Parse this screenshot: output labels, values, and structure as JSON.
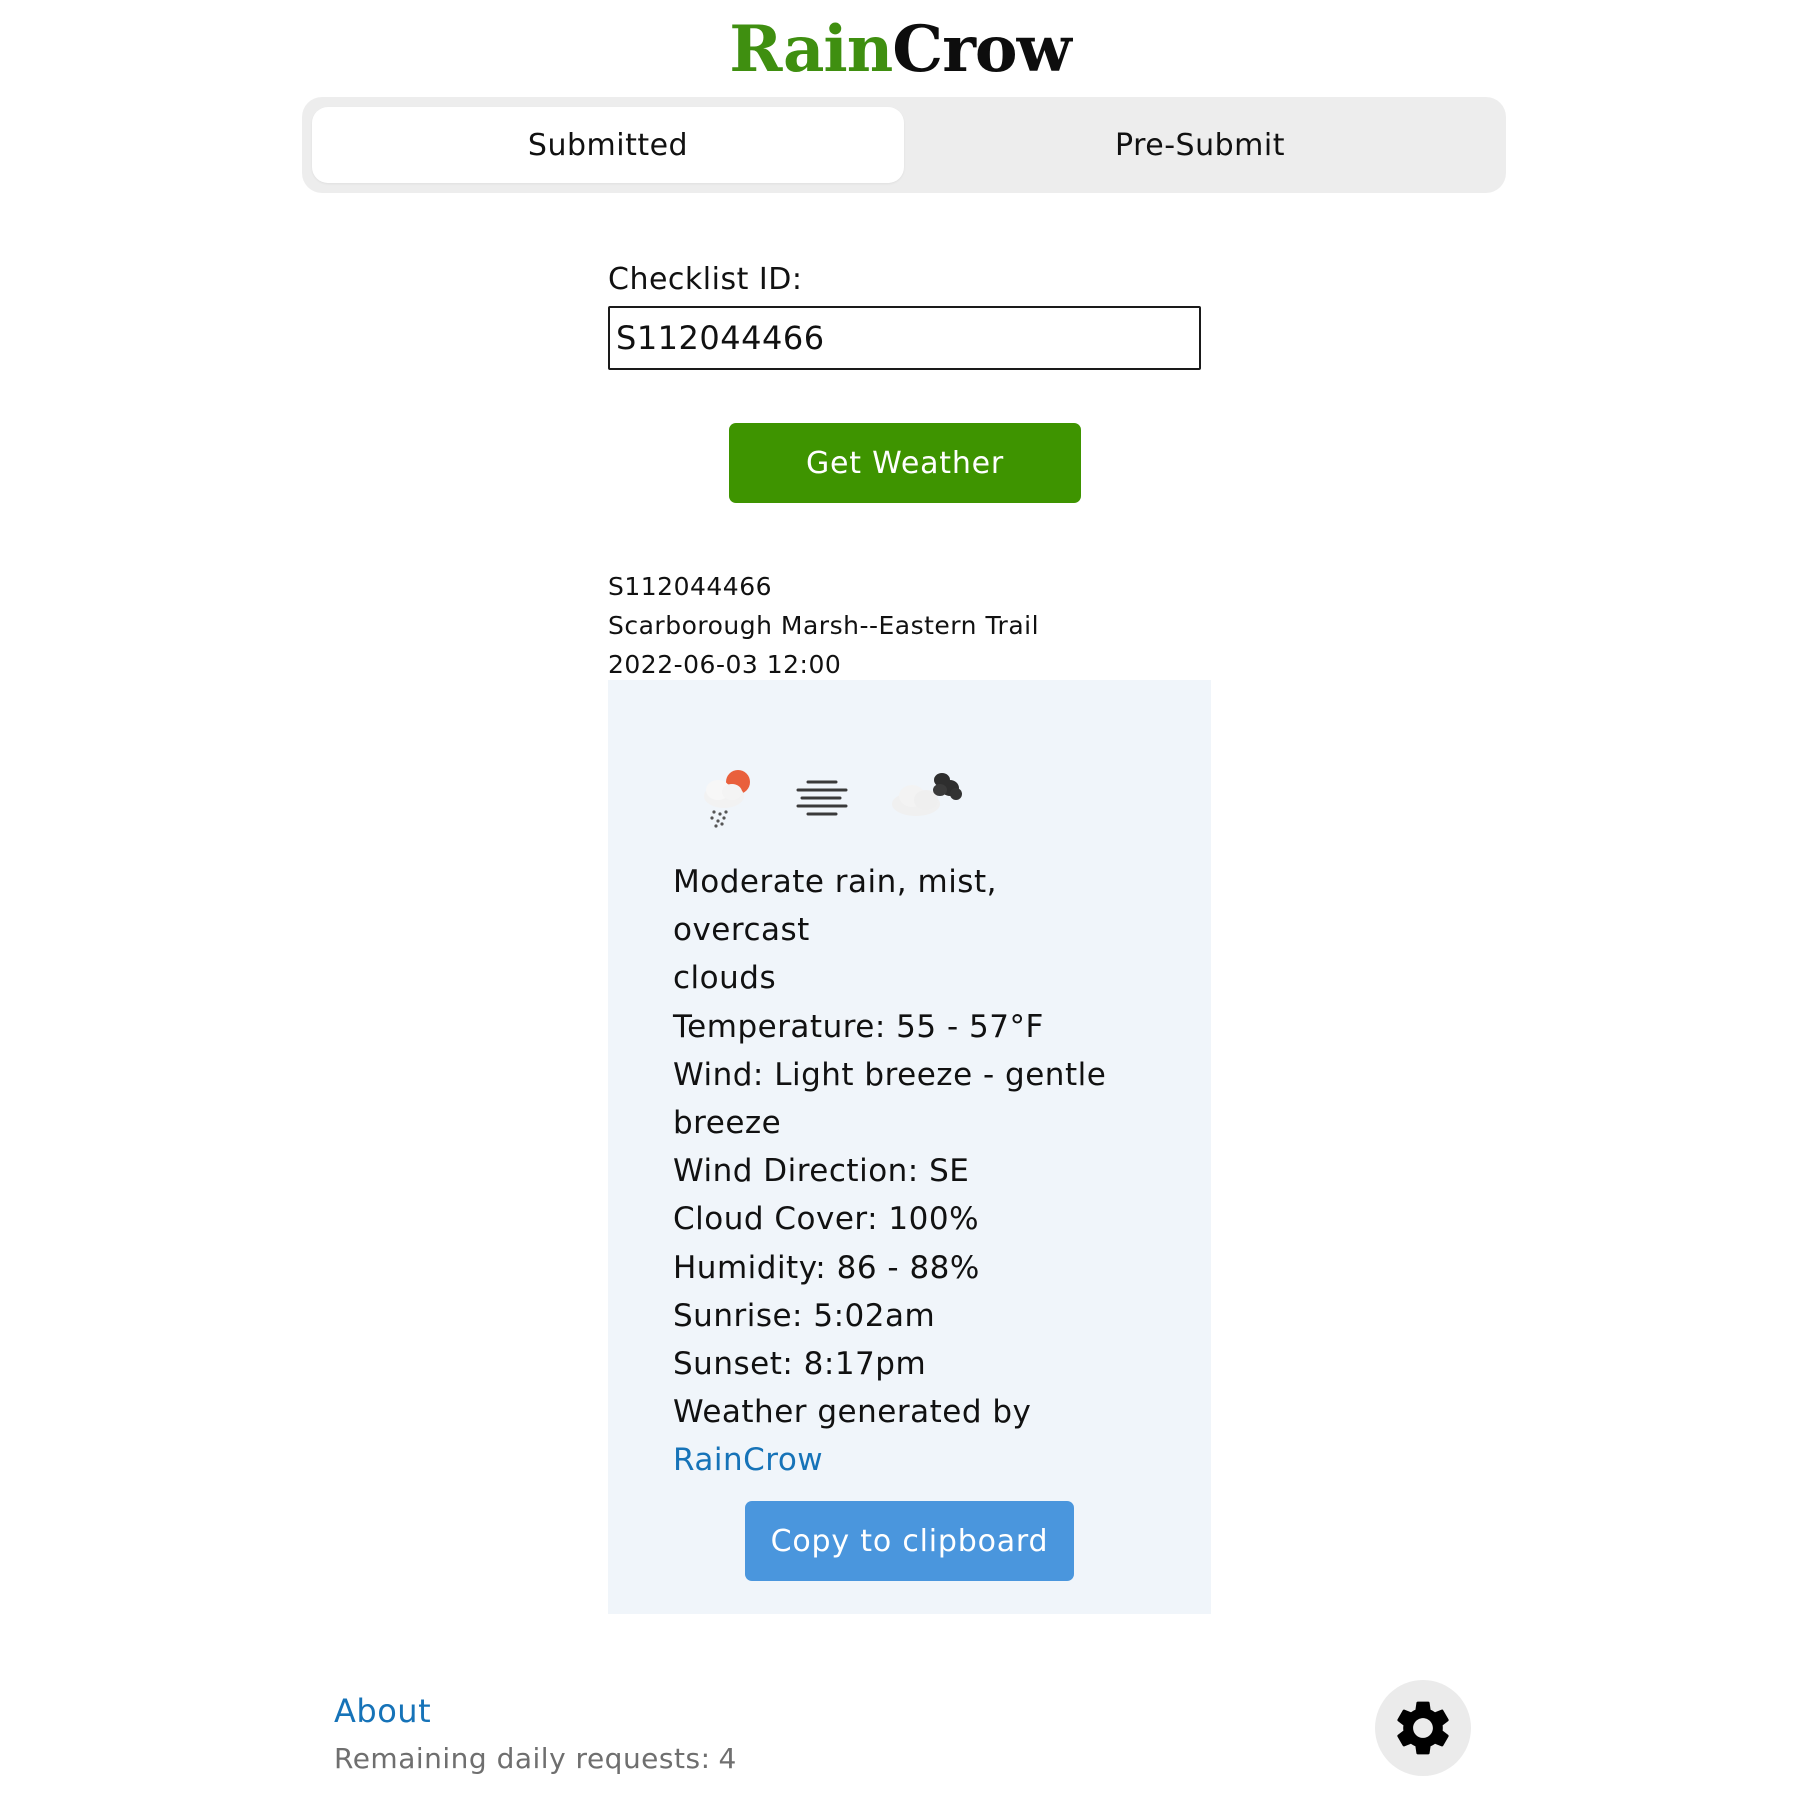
{
  "logo": {
    "part1": "Rain",
    "part2": "Crow"
  },
  "tabs": [
    {
      "label": "Submitted",
      "active": true
    },
    {
      "label": "Pre-Submit",
      "active": false
    }
  ],
  "form": {
    "label": "Checklist ID:",
    "value": "S112044466",
    "submit_label": "Get Weather"
  },
  "checklist": {
    "id": "S112044466",
    "location": "Scarborough Marsh--Eastern Trail",
    "datetime": "2022-06-03 12:00"
  },
  "weather": {
    "icons": [
      "rain-cloud-sun-icon",
      "mist-icon",
      "overcast-clouds-icon"
    ],
    "lines": [
      "Moderate rain, mist, overcast",
      "clouds",
      "Temperature: 55 - 57°F",
      "Wind: Light breeze - gentle",
      "breeze",
      "Wind Direction: SE",
      "Cloud Cover: 100%",
      "Humidity: 86 - 88%",
      "Sunrise: 5:02am",
      "Sunset: 8:17pm",
      "Weather generated by"
    ],
    "credit_link": "RainCrow",
    "copy_label": "Copy to clipboard"
  },
  "footer": {
    "about_label": "About",
    "remaining_label": "Remaining daily requests:",
    "remaining_count": "4",
    "settings_icon": "gear-icon"
  },
  "colors": {
    "brand_green": "#3e9400",
    "logo_green": "#3f8f10",
    "link_blue": "#1673b8",
    "button_blue": "#4a96dd",
    "panel_bg": "#f0f5fa",
    "tab_bg": "#ededed"
  }
}
